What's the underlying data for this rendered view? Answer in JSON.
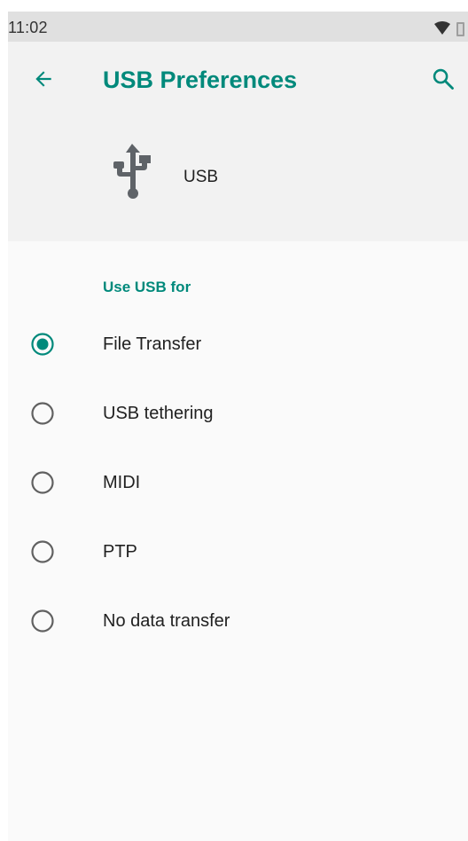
{
  "status_bar": {
    "time": "11:02",
    "icons": [
      "wifi-icon",
      "battery-icon"
    ]
  },
  "header": {
    "title": "USB Preferences",
    "back_icon": "arrow-back-icon",
    "search_icon": "search-icon",
    "device_icon": "usb-icon",
    "device_label": "USB"
  },
  "section": {
    "title": "Use USB for"
  },
  "options": [
    {
      "label": "File Transfer",
      "selected": true
    },
    {
      "label": "USB tethering",
      "selected": false
    },
    {
      "label": "MIDI",
      "selected": false
    },
    {
      "label": "PTP",
      "selected": false
    },
    {
      "label": "No data transfer",
      "selected": false
    }
  ],
  "colors": {
    "accent": "#00897b",
    "header_bg": "#f2f2f2",
    "body_bg": "#fafafa",
    "status_bg": "#e0e0e0"
  }
}
